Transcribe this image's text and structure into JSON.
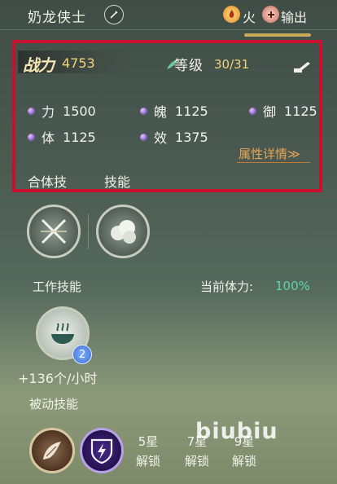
{
  "header": {
    "name": "奶龙侠士",
    "edit_icon": "pencil-icon",
    "element": "火",
    "element_icon": "fire-icon",
    "role": "输出",
    "role_icon": "output-icon"
  },
  "stats_panel": {
    "power_label": "战力",
    "power_value": "4753",
    "level_label": "等级",
    "level_value": "30/31",
    "attributes": [
      {
        "name": "力",
        "value": "1500"
      },
      {
        "name": "魄",
        "value": "1125"
      },
      {
        "name": "御",
        "value": "1125"
      },
      {
        "name": "体",
        "value": "1125"
      },
      {
        "name": "效",
        "value": "1375"
      }
    ],
    "detail_link": "属性详情≫",
    "tabs": [
      "合体技",
      "技能"
    ],
    "highlight_color": "#c8102e"
  },
  "skills": {
    "active": [
      {
        "icon": "crossed-swords-icon"
      },
      {
        "icon": "smoke-cloud-icon"
      }
    ]
  },
  "work": {
    "title": "工作技能",
    "stamina_label": "当前体力:",
    "stamina_value": "100%",
    "skill_icon": "steaming-bowl-icon",
    "skill_level": "2",
    "rate": "+136个/小时"
  },
  "passive": {
    "title": "被动技能",
    "icons": [
      "wing-icon",
      "lightning-shield-icon"
    ],
    "locks": [
      {
        "stars": "5星",
        "label": "解锁"
      },
      {
        "stars": "7星",
        "label": "解锁"
      },
      {
        "stars": "9星",
        "label": "解锁"
      }
    ]
  },
  "watermark": "biubiu",
  "colors": {
    "accent_gold": "#f2d27a",
    "stamina": "#5bd6a8",
    "link": "#e8a455"
  }
}
